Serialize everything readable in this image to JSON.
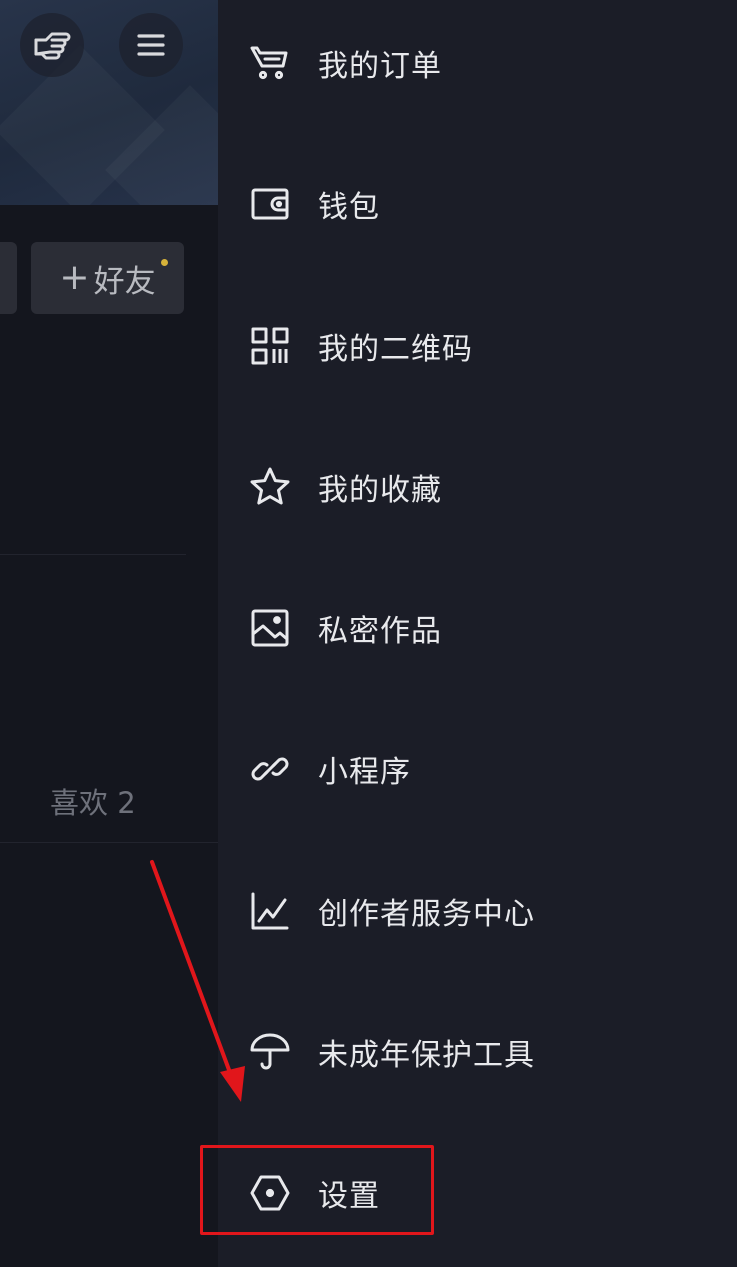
{
  "profile": {
    "add_friend_label": "好友",
    "likes_text": "喜欢 2"
  },
  "menu": {
    "items": [
      {
        "label": "我的订单",
        "icon": "cart-icon"
      },
      {
        "label": "钱包",
        "icon": "wallet-icon"
      },
      {
        "label": "我的二维码",
        "icon": "qr-code-icon"
      },
      {
        "label": "我的收藏",
        "icon": "star-icon"
      },
      {
        "label": "私密作品",
        "icon": "image-icon"
      },
      {
        "label": "小程序",
        "icon": "link-icon"
      },
      {
        "label": "创作者服务中心",
        "icon": "chart-line-icon"
      },
      {
        "label": "未成年保护工具",
        "icon": "umbrella-icon"
      },
      {
        "label": "设置",
        "icon": "settings-hexagon-icon"
      }
    ]
  },
  "annotation": {
    "highlight_color": "#e1161b",
    "highlighted_item": "设置"
  }
}
